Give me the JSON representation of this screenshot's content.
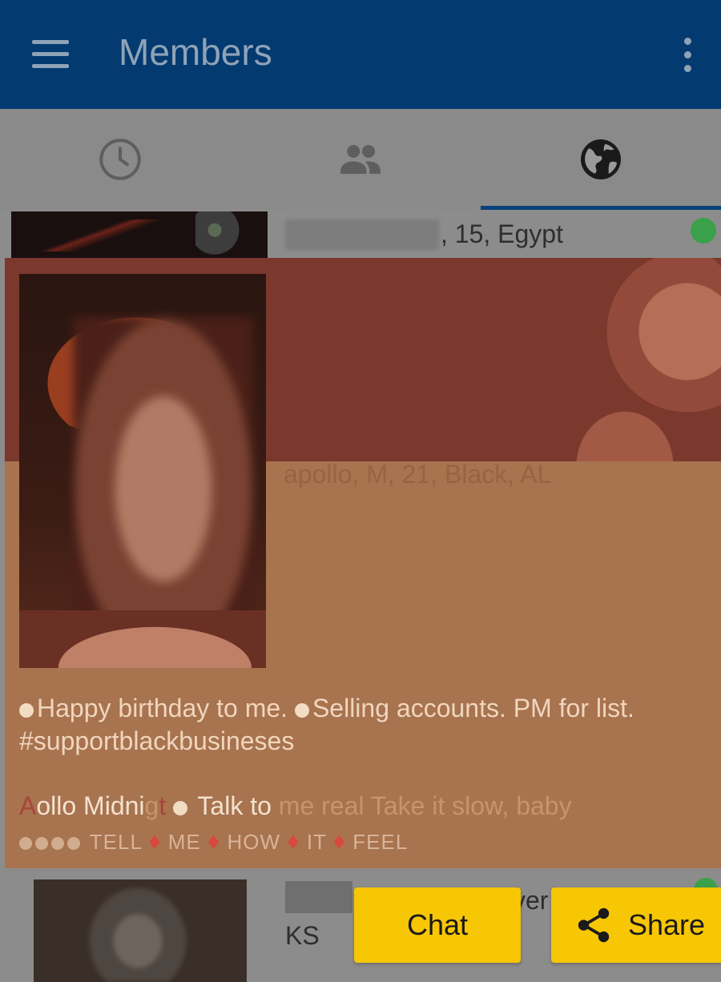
{
  "appbar": {
    "title": "Members"
  },
  "tabs": [
    {
      "icon": "clock-icon",
      "active": false
    },
    {
      "icon": "people-icon",
      "active": false
    },
    {
      "icon": "globe-icon",
      "active": true
    }
  ],
  "list": {
    "row1": {
      "details": ", 15, Egypt",
      "status": "online"
    },
    "row2": {
      "line_fragment": "ver",
      "sub": "KS",
      "status": "online"
    }
  },
  "card": {
    "subtitle": "apollo, M, 21, Black, AL",
    "bio_line1": "Happy birthday to me.",
    "bio_line1b": "Selling accounts. PM for list. #supportblackbusineses",
    "bio_line2": {
      "a": "A",
      "b": "ollo Midni",
      "c": "g",
      "d": "t",
      "e": "Talk to",
      "f": "me real Take it slow, baby"
    },
    "bio_line3": [
      "TELL",
      "ME",
      "HOW",
      "IT",
      "FEEL"
    ]
  },
  "actions": {
    "chat_label": "Chat",
    "share_label": "Share"
  },
  "colors": {
    "appbar": "#033a70",
    "accent_button": "#f7c604",
    "online": "#3aa04a"
  }
}
